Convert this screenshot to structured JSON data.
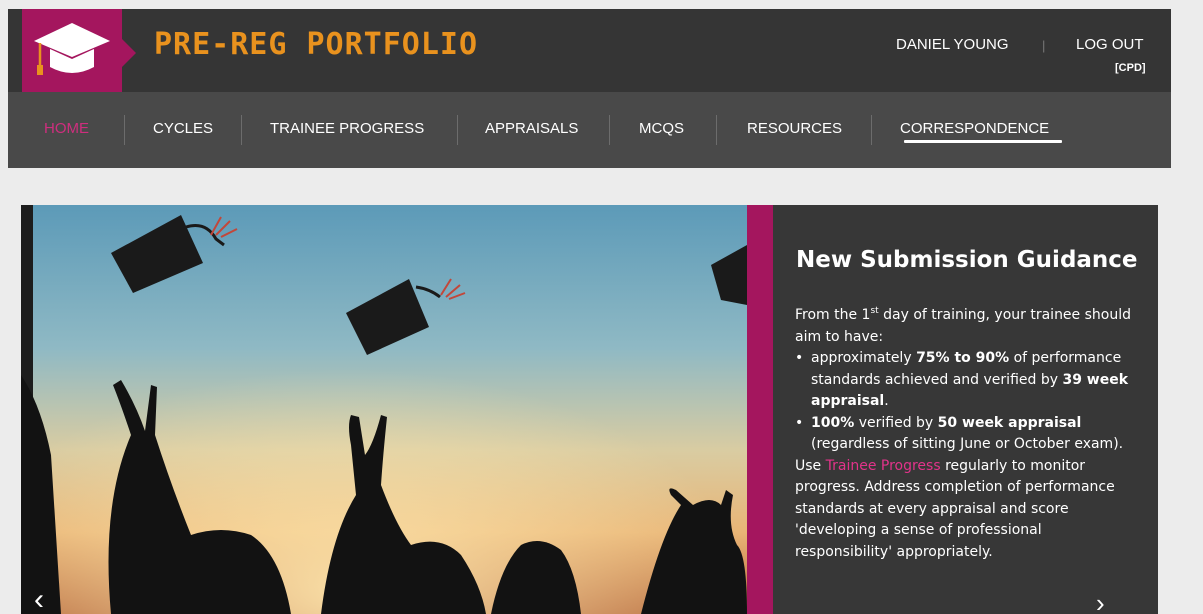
{
  "header": {
    "brand": "PRE-REG PORTFOLIO",
    "logo_icon": "graduation-cap-icon",
    "user_name": "DANIEL YOUNG",
    "separator": "|",
    "logout": "LOG OUT",
    "cpd": "[CPD]"
  },
  "nav": {
    "items": [
      {
        "label": "HOME",
        "active": true
      },
      {
        "label": "CYCLES"
      },
      {
        "label": "TRAINEE PROGRESS"
      },
      {
        "label": "APPRAISALS"
      },
      {
        "label": "MCQS"
      },
      {
        "label": "RESOURCES"
      },
      {
        "label": "CORRESPONDENCE",
        "underlined": true
      }
    ]
  },
  "hero": {
    "prev_icon": "chevron-left-icon",
    "next_icon": "chevron-right-icon",
    "panel": {
      "title": "New Submission Guidance",
      "intro_1": "From the 1",
      "intro_sup": "st",
      "intro_2": " day of training, your trainee should aim to have:",
      "b1_pre": "approximately ",
      "b1_bold1": "75% to 90%",
      "b1_mid": " of performance standards achieved and verified by ",
      "b1_bold2": "39 week appraisal",
      "b1_end": ".",
      "b2_bold1": "100%",
      "b2_mid": " verified by ",
      "b2_bold2": "50 week appraisal",
      "b2_end": " (regardless of sitting June or October exam).",
      "use_pre": "Use ",
      "use_link": "Trainee Progress",
      "use_post": " regularly to monitor progress. Address completion of performance standards at every appraisal and score 'developing a sense of professional responsibility' appropriately."
    }
  },
  "colors": {
    "magenta": "#a4165e",
    "brand_orange": "#e9921e",
    "header_bg": "#353535",
    "nav_bg": "#494949",
    "active_pink": "#cf2e7e",
    "link_pink": "#e2338a"
  }
}
